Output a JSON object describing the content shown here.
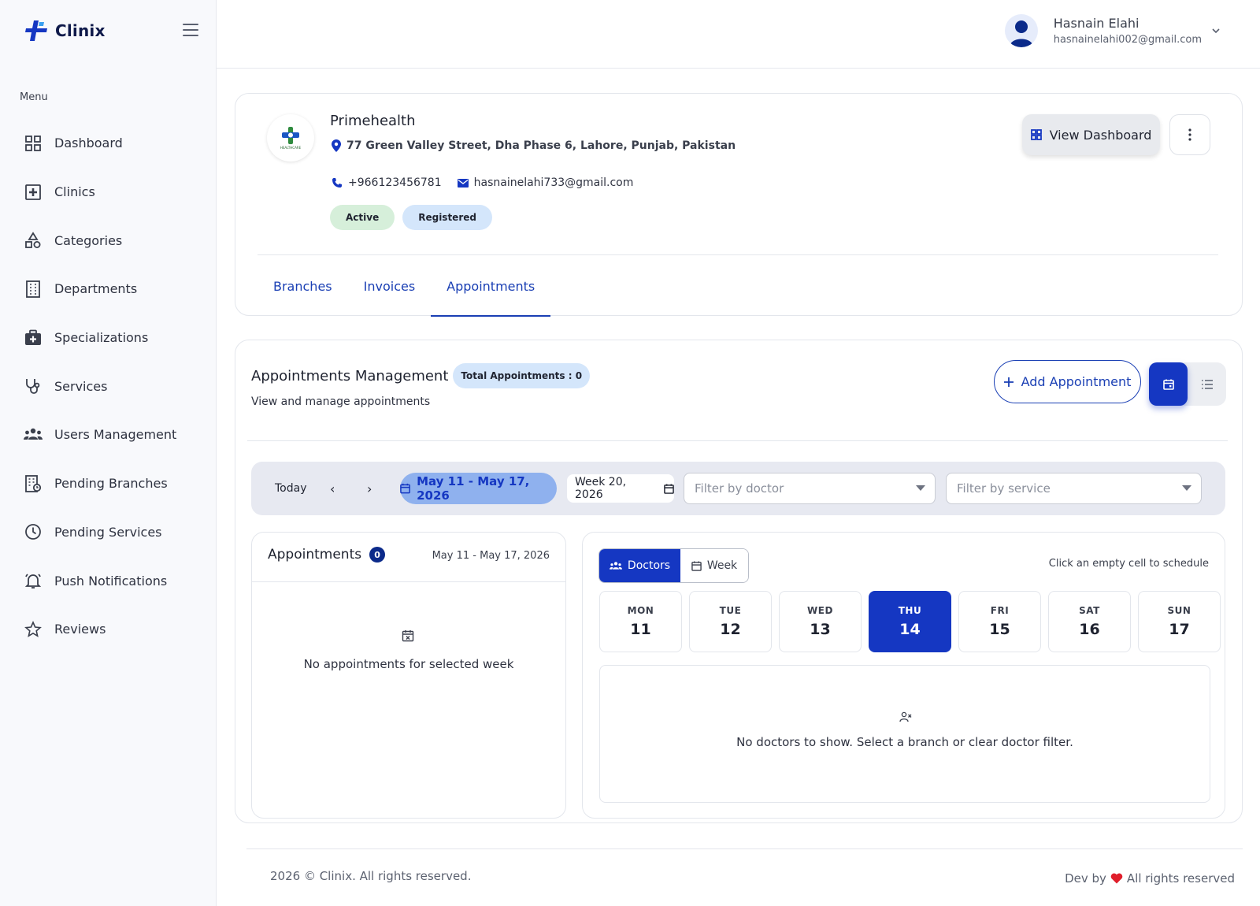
{
  "brand": {
    "name": "Clinix",
    "accent": "#1537c2"
  },
  "sidebar": {
    "menu_caption": "Menu",
    "items": [
      {
        "label": "Dashboard",
        "icon": "grid-icon"
      },
      {
        "label": "Clinics",
        "icon": "plus-square-icon"
      },
      {
        "label": "Categories",
        "icon": "shapes-icon"
      },
      {
        "label": "Departments",
        "icon": "building-icon"
      },
      {
        "label": "Specializations",
        "icon": "medical-bag-icon"
      },
      {
        "label": "Services",
        "icon": "stethoscope-icon"
      },
      {
        "label": "Users Management",
        "icon": "users-icon"
      },
      {
        "label": "Pending Branches",
        "icon": "building-clock-icon"
      },
      {
        "label": "Pending Services",
        "icon": "clock-icon"
      },
      {
        "label": "Push Notifications",
        "icon": "bell-icon"
      },
      {
        "label": "Reviews",
        "icon": "star-icon"
      }
    ]
  },
  "header": {
    "user_name": "Hasnain Elahi",
    "user_email": "hasnainelahi002@gmail.com"
  },
  "clinic": {
    "name": "Primehealth",
    "logo_text": "HEALTHCARE",
    "address": "77 Green Valley Street, Dha Phase 6, Lahore, Punjab, Pakistan",
    "phone": "+966123456781",
    "email": "hasnainelahi733@gmail.com",
    "badges": {
      "status": "Active",
      "registration": "Registered"
    },
    "view_dashboard_label": "View Dashboard",
    "tabs": [
      "Branches",
      "Invoices",
      "Appointments"
    ],
    "active_tab": "Appointments"
  },
  "appointments": {
    "title": "Appointments Management",
    "total_badge": "Total Appointments : 0",
    "subtitle": "View and manage appointments",
    "add_label": "Add Appointment",
    "view_mode": "calendar",
    "filters": {
      "today_label": "Today",
      "prev": "‹",
      "next": "›",
      "range_label": "May 11 - May 17, 2026",
      "week_value": "Week 20, 2026",
      "doctor_placeholder": "Filter by doctor",
      "service_placeholder": "Filter by service"
    },
    "list": {
      "title": "Appointments",
      "count": "0",
      "range": "May 11 - May 17, 2026",
      "empty_text": "No appointments for selected week"
    },
    "calendar": {
      "mode_doctors": "Doctors",
      "mode_week": "Week",
      "hint": "Click an empty cell to schedule",
      "days": [
        {
          "name": "MON",
          "date": "11"
        },
        {
          "name": "TUE",
          "date": "12"
        },
        {
          "name": "WED",
          "date": "13"
        },
        {
          "name": "THU",
          "date": "14"
        },
        {
          "name": "FRI",
          "date": "15"
        },
        {
          "name": "SAT",
          "date": "16"
        },
        {
          "name": "SUN",
          "date": "17"
        }
      ],
      "selected_day": "THU",
      "empty_text": "No doctors to show. Select a branch or clear doctor filter."
    }
  },
  "footer": {
    "copyright": "2026 © Clinix. All rights reserved.",
    "dev_by": "Dev by",
    "rights": "All rights reserved"
  }
}
